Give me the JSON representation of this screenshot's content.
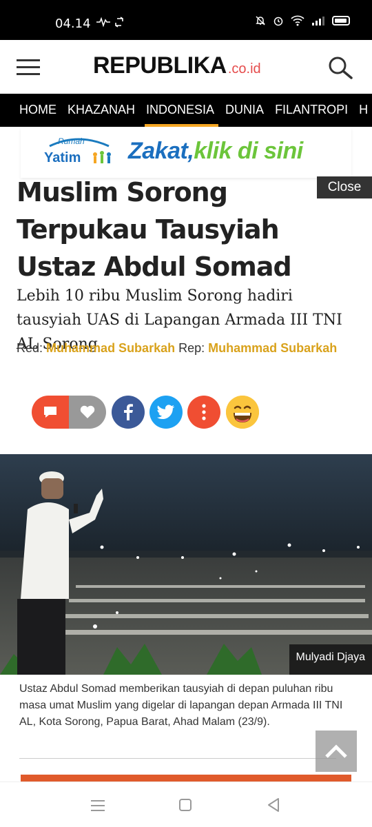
{
  "status_bar": {
    "time": "04.14"
  },
  "header": {
    "logo": "REPUBLIKA",
    "logo_tld": ".co.id"
  },
  "nav": {
    "items": [
      "HOME",
      "KHAZANAH",
      "INDONESIA",
      "DUNIA",
      "FILANTROPI",
      "H"
    ],
    "active_index": 2
  },
  "ad": {
    "logo_top": "Rumah",
    "logo_main": "Yatim",
    "text_a": "Zakat,",
    "text_b": "klik di sini",
    "close_label": "Close"
  },
  "article": {
    "title": "Muslim Sorong Terpukau Tausyiah Ustaz Abdul Somad",
    "subtitle": "Lebih 10 ribu Muslim Sorong hadiri tausyiah UAS di Lapangan Armada III TNI AL Sorong",
    "byline": {
      "red_label": "Red:",
      "red_name": "Muhammad Subarkah",
      "rep_label": "Rep:",
      "rep_name": "Muhammad Subarkah"
    },
    "photo_credit": "Mulyadi Djaya",
    "caption": "Ustaz Abdul Somad memberikan tausyiah di depan puluhan ribu masa umat Muslim yang digelar di lapangan depan Armada III TNI AL, Kota Sorong, Papua Barat, Ahad Malam (23/9)."
  },
  "colors": {
    "accent": "#d9a21c",
    "nav_active": "#f5a623",
    "facebook": "#3b5998",
    "twitter": "#1da1f2",
    "comment": "#f04e32"
  },
  "icons": [
    "comment-icon",
    "heart-icon",
    "facebook-icon",
    "twitter-icon",
    "more-icon",
    "emoji-icon",
    "search-icon",
    "menu-icon",
    "arrow-up-icon"
  ]
}
